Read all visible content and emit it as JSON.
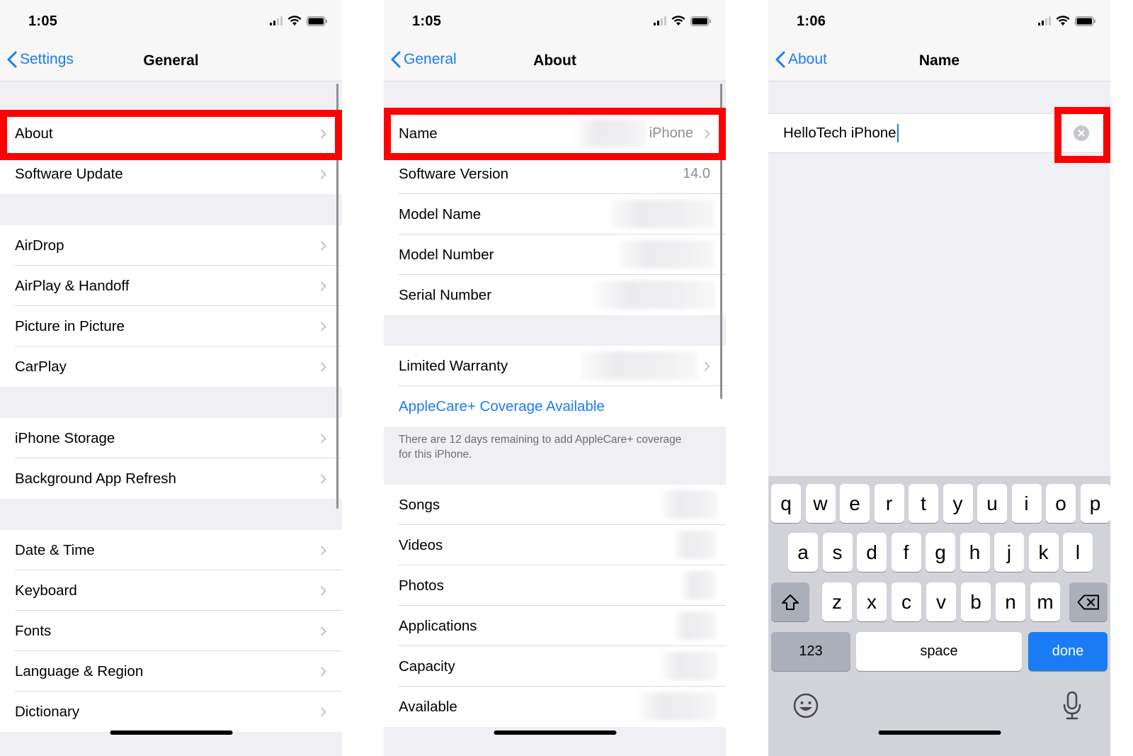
{
  "panels": {
    "general": {
      "status_time": "1:05",
      "back_label": "Settings",
      "title": "General",
      "groups": [
        [
          "About",
          "Software Update"
        ],
        [
          "AirDrop",
          "AirPlay & Handoff",
          "Picture in Picture",
          "CarPlay"
        ],
        [
          "iPhone Storage",
          "Background App Refresh"
        ],
        [
          "Date & Time",
          "Keyboard",
          "Fonts",
          "Language & Region",
          "Dictionary"
        ]
      ]
    },
    "about": {
      "status_time": "1:05",
      "back_label": "General",
      "title": "About",
      "rows": [
        {
          "label": "Name",
          "value": "iPhone"
        },
        {
          "label": "Software Version",
          "value": "14.0"
        },
        {
          "label": "Model Name",
          "value": ""
        },
        {
          "label": "Model Number",
          "value": ""
        },
        {
          "label": "Serial Number",
          "value": ""
        }
      ],
      "warranty_label": "Limited Warranty",
      "applecare_link": "AppleCare+ Coverage Available",
      "applecare_footnote": "There are 12 days remaining to add AppleCare+ coverage for this iPhone.",
      "stats_rows": [
        "Songs",
        "Videos",
        "Photos",
        "Applications",
        "Capacity",
        "Available"
      ]
    },
    "name": {
      "status_time": "1:06",
      "back_label": "About",
      "title": "Name",
      "field_value": "HelloTech iPhone"
    }
  },
  "keyboard": {
    "row1": [
      "q",
      "w",
      "e",
      "r",
      "t",
      "y",
      "u",
      "i",
      "o",
      "p"
    ],
    "row2": [
      "a",
      "s",
      "d",
      "f",
      "g",
      "h",
      "j",
      "k",
      "l"
    ],
    "row3": [
      "z",
      "x",
      "c",
      "v",
      "b",
      "n",
      "m"
    ],
    "numbers_label": "123",
    "space_label": "space",
    "done_label": "done"
  },
  "colors": {
    "accent": "#1a7cf5",
    "highlight": "#ff0000"
  }
}
